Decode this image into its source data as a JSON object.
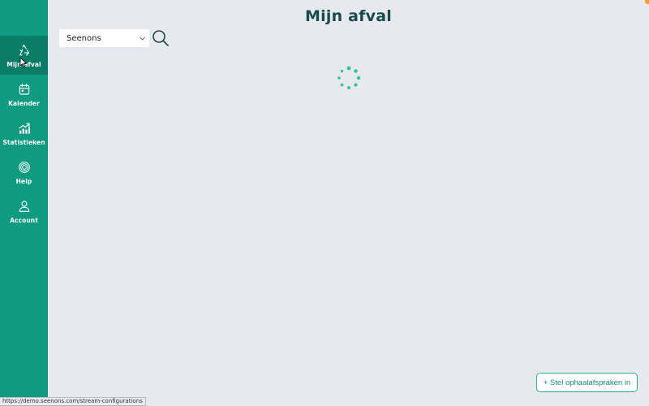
{
  "page": {
    "title": "Mijn afval"
  },
  "sidebar": {
    "items": [
      {
        "label": "Mijn afval",
        "icon": "recycle-icon",
        "active": true
      },
      {
        "label": "Kalender",
        "icon": "calendar-icon",
        "active": false
      },
      {
        "label": "Statistieken",
        "icon": "stats-chart-icon",
        "active": false
      },
      {
        "label": "Help",
        "icon": "help-lifebuoy-icon",
        "active": false
      },
      {
        "label": "Account",
        "icon": "user-icon",
        "active": false
      }
    ]
  },
  "filters": {
    "organization_select": {
      "value": "Seenons"
    },
    "search_icon": "search-icon"
  },
  "content": {
    "state": "loading",
    "spinner_icon": "loading-spinner-icon"
  },
  "actions": {
    "schedule_pickup_label": "+ Stel ophaalafspraken in"
  },
  "browser": {
    "status_url": "https://demo.seenons.com/stream-configurations"
  },
  "colors": {
    "sidebar": "#0e9b80",
    "sidebar_active": "#0b7d67",
    "background": "#e7e9ee",
    "title": "#184b4e",
    "accent": "#22b39a",
    "spinner": "#2fc3a8"
  }
}
